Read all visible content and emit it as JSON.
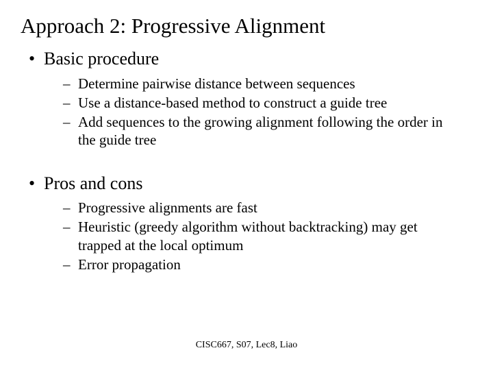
{
  "title": "Approach 2: Progressive Alignment",
  "section1": {
    "heading": "Basic procedure",
    "items": [
      "Determine pairwise distance between sequences",
      "Use a distance-based method to construct a guide tree",
      "Add sequences to the growing alignment following the order in the guide tree"
    ]
  },
  "section2": {
    "heading": "Pros and cons",
    "items": [
      "Progressive alignments are fast",
      "Heuristic (greedy algorithm without backtracking) may get trapped at the local optimum",
      "Error propagation"
    ]
  },
  "footer": "CISC667, S07, Lec8, Liao"
}
